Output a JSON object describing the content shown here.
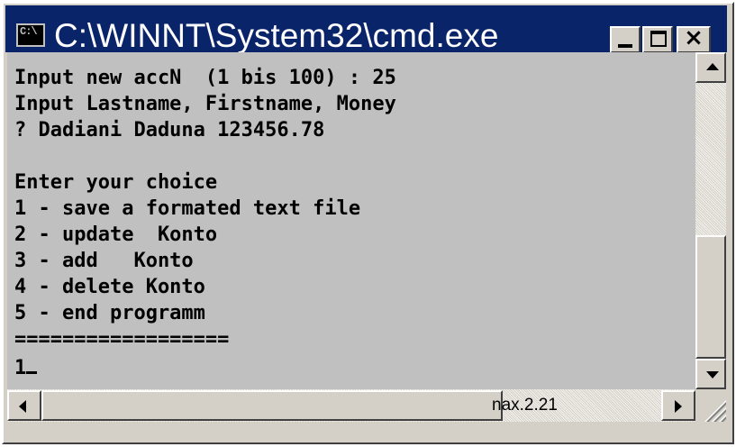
{
  "window": {
    "title": "C:\\WINNT\\System32\\cmd.exe",
    "title_bar_color": "#0a246a",
    "console_background": "#c0c0c0",
    "icon": "console-icon",
    "icon_label": "C:\\"
  },
  "title_buttons": {
    "minimize": "minimize-icon",
    "maximize": "maximize-icon",
    "close": "×"
  },
  "console": {
    "lines": [
      "Input new accN  (1 bis 100) : 25",
      "Input Lastname, Firstname, Money",
      "? Dadiani Daduna 123456.78",
      "",
      "Enter your choice",
      "1 - save a formated text file",
      "2 - update  Konto",
      "3 - add   Konto",
      "4 - delete Konto",
      "5 - end programm",
      "==================",
      "1"
    ]
  },
  "scrollbars": {
    "vertical_position": 0.55,
    "horizontal_label": "nax.2.21"
  }
}
